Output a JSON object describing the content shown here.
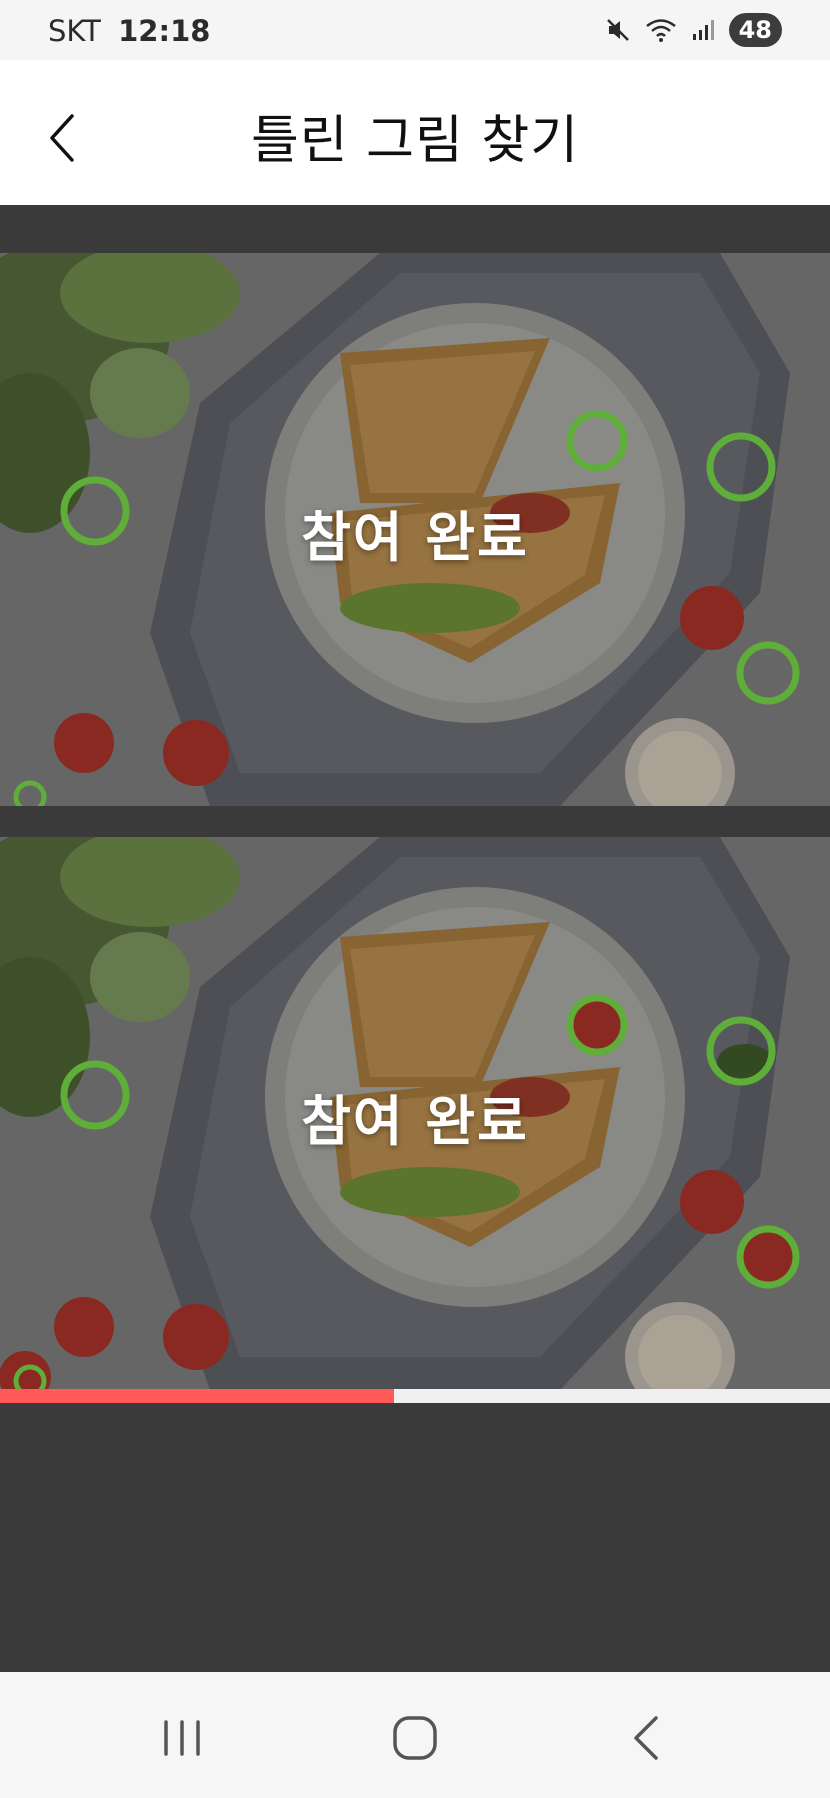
{
  "status_bar": {
    "carrier": "SKT",
    "time": "12:18",
    "battery": "48",
    "icons": [
      "mute-icon",
      "wifi-icon",
      "signal-icon"
    ]
  },
  "header": {
    "title": "틀린 그림 찾기",
    "back_icon": "back-chevron-icon"
  },
  "game": {
    "top_image_overlay": "참여 완료",
    "bottom_image_overlay": "참여 완료",
    "progress": 0.475,
    "accent_color": "#ff5a57",
    "marker_color": "#5fae3a"
  },
  "nav_bar": {
    "items": [
      "recent-apps-icon",
      "home-icon",
      "back-icon"
    ]
  }
}
